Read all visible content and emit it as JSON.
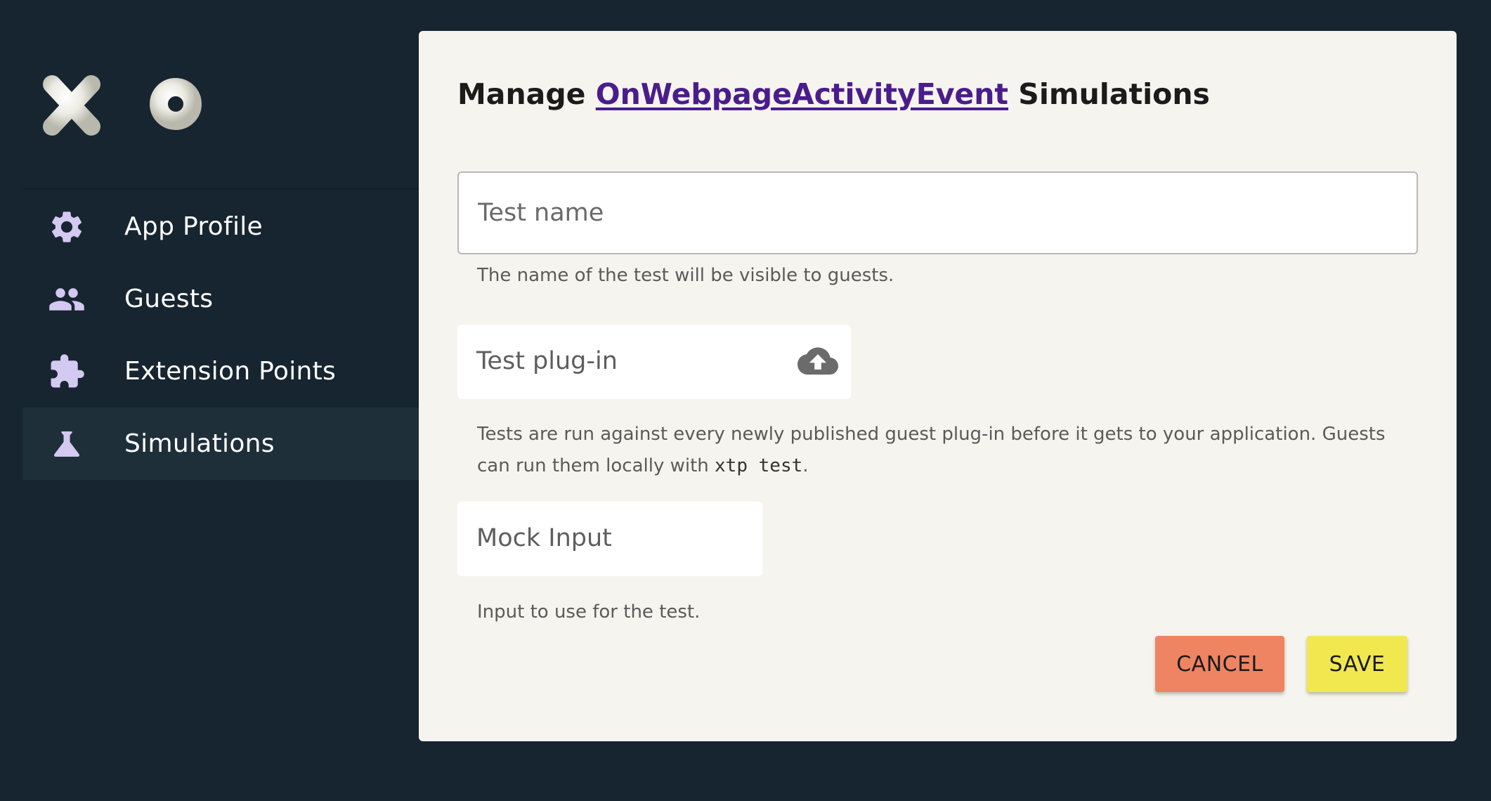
{
  "brand": {
    "logo_text": "xtp"
  },
  "sidebar": {
    "items": [
      {
        "label": "App Profile",
        "icon": "gear-icon",
        "active": false
      },
      {
        "label": "Guests",
        "icon": "people-icon",
        "active": false
      },
      {
        "label": "Extension Points",
        "icon": "puzzle-icon",
        "active": false
      },
      {
        "label": "Simulations",
        "icon": "flask-icon",
        "active": true
      }
    ]
  },
  "main": {
    "title_prefix": "Manage ",
    "title_link": "OnWebpageActivityEvent",
    "title_suffix": " Simulations",
    "test_name": {
      "placeholder": "Test name",
      "value": "",
      "helper": "The name of the test will be visible to guests."
    },
    "test_plugin": {
      "label": "Test plug-in",
      "icon": "cloud-upload-icon",
      "helper_pre": "Tests are run against every newly published guest plug-in before it gets to your application. Guests can run them locally with ",
      "helper_code": "xtp test",
      "helper_post": "."
    },
    "mock_input": {
      "label": "Mock Input",
      "helper": "Input to use for the test."
    },
    "buttons": {
      "cancel": "CANCEL",
      "save": "SAVE"
    }
  },
  "colors": {
    "background": "#172530",
    "panel": "#f5f4ee",
    "link": "#4a1c8c",
    "icon_tint": "#d4c9f1",
    "cancel": "#ef8462",
    "save": "#f0e84e"
  }
}
